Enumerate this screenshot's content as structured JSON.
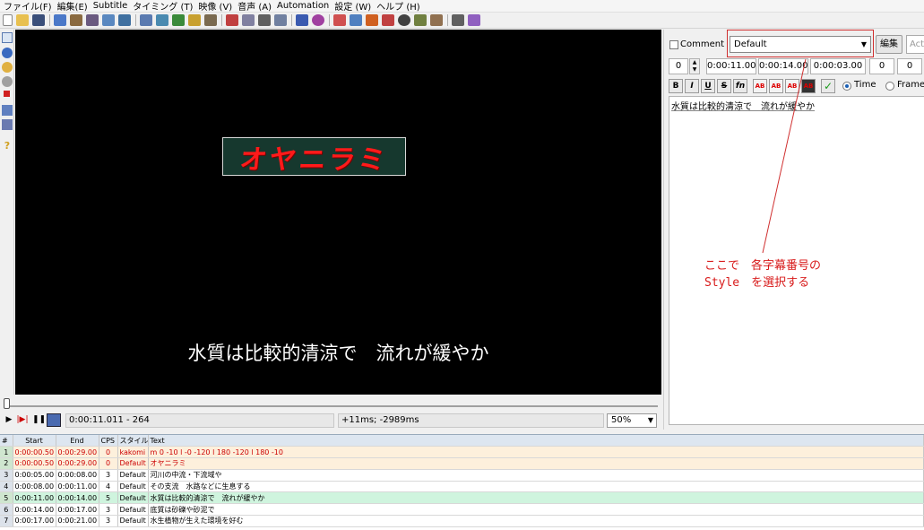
{
  "menu": [
    "ファイル(F)",
    "編集(E)",
    "Subtitle",
    "タイミング (T)",
    "映像 (V)",
    "音声 (A)",
    "Automation",
    "設定 (W)",
    "ヘルプ (H)"
  ],
  "video": {
    "logo_text": "オヤニラミ",
    "subtitle_text": "水質は比較的清涼で　流れが緩やか"
  },
  "transport": {
    "time": "0:00:11.011 - 264",
    "offset": "+11ms; -2989ms",
    "zoom": "50%"
  },
  "edit": {
    "comment_label": "Comment",
    "style": "Default",
    "edit_button": "編集",
    "actor_placeholder": "Actor",
    "layer": "0",
    "start": "0:00:11.00",
    "end": "0:00:14.00",
    "duration": "0:00:03.00",
    "margin_l": "0",
    "margin_r": "0",
    "fmt_bold": "B",
    "fmt_italic": "I",
    "fmt_underline": "U",
    "fmt_strike": "S",
    "fmt_font": "fn",
    "fmt_color": "AB",
    "radio_time": "Time",
    "radio_frame": "Frame",
    "text": "水質は比較的清涼で　流れが緩やか"
  },
  "annotation": {
    "line1": "ここで　各字幕番号の",
    "line2": "Style　を選択する"
  },
  "grid": {
    "headers": [
      "#",
      "Start",
      "End",
      "CPS",
      "スタイル",
      "Text"
    ],
    "rows": [
      {
        "n": "1",
        "start": "0:00:00.50",
        "end": "0:00:29.00",
        "cps": "0",
        "style": "kakomi",
        "text": "m 0 -10 l -0 -120 l 180 -120 l 180 -10"
      },
      {
        "n": "2",
        "start": "0:00:00.50",
        "end": "0:00:29.00",
        "cps": "0",
        "style": "Default",
        "text": "オヤニラミ"
      },
      {
        "n": "3",
        "start": "0:00:05.00",
        "end": "0:00:08.00",
        "cps": "3",
        "style": "Default",
        "text": "河川の中流・下流域や"
      },
      {
        "n": "4",
        "start": "0:00:08.00",
        "end": "0:00:11.00",
        "cps": "4",
        "style": "Default",
        "text": "その支流　水路などに生息する"
      },
      {
        "n": "5",
        "start": "0:00:11.00",
        "end": "0:00:14.00",
        "cps": "5",
        "style": "Default",
        "text": "水質は比較的清涼で　流れが緩やか"
      },
      {
        "n": "6",
        "start": "0:00:14.00",
        "end": "0:00:17.00",
        "cps": "3",
        "style": "Default",
        "text": "底質は砂礫や砂泥で"
      },
      {
        "n": "7",
        "start": "0:00:17.00",
        "end": "0:00:21.00",
        "cps": "3",
        "style": "Default",
        "text": "水生植物が生えた環境を好む"
      }
    ]
  }
}
